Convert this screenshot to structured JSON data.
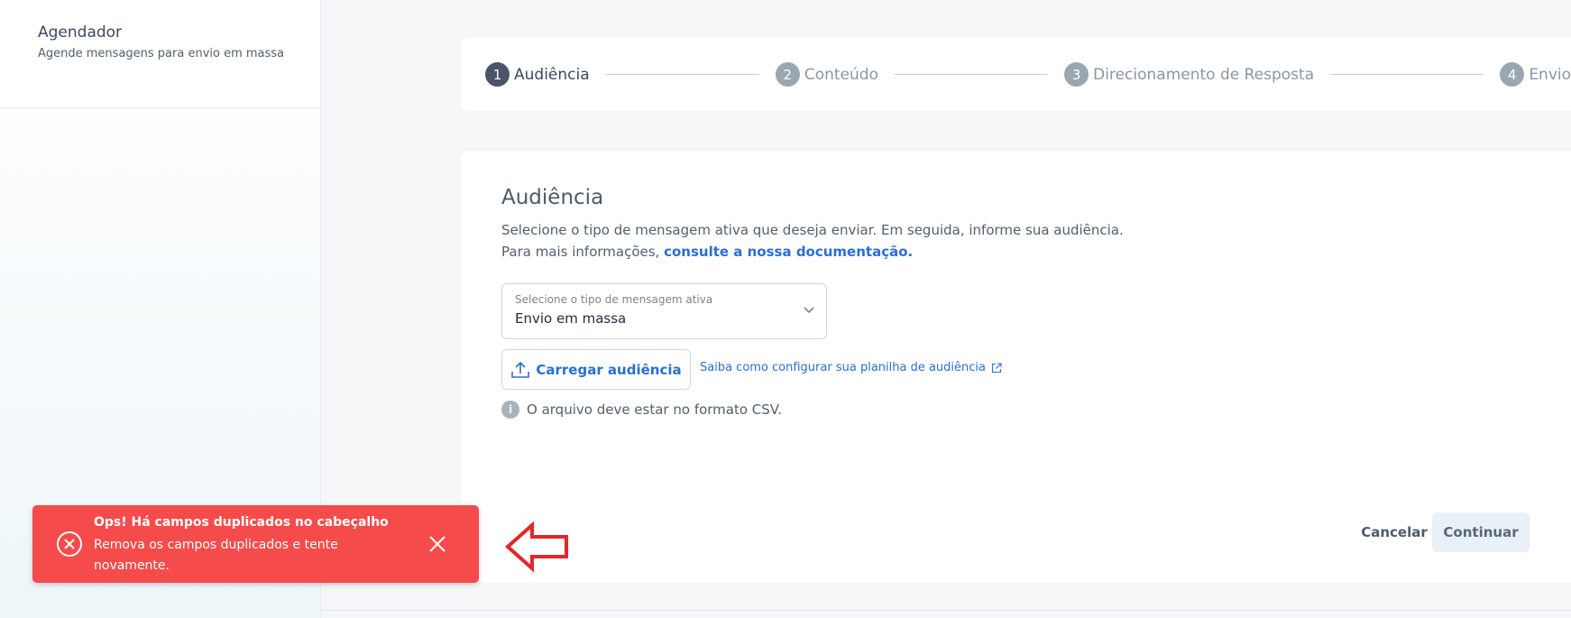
{
  "sidebar": {
    "title": "Agendador",
    "subtitle": "Agende mensagens para envio em massa"
  },
  "stepper": {
    "steps": [
      {
        "num": "1",
        "label": "Audiência",
        "active": true
      },
      {
        "num": "2",
        "label": "Conteúdo",
        "active": false
      },
      {
        "num": "3",
        "label": "Direcionamento de Resposta",
        "active": false
      },
      {
        "num": "4",
        "label": "Envio",
        "active": false
      }
    ]
  },
  "main": {
    "title": "Audiência",
    "description": "Selecione o tipo de mensagem ativa que deseja enviar. Em seguida, informe sua audiência. Para mais informações, ",
    "doc_link": "consulte a nossa documentação.",
    "select": {
      "label": "Selecione o tipo de mensagem ativa",
      "value": "Envio em massa"
    },
    "upload_label": "Carregar audiência",
    "help_link": "Saiba como configurar sua planilha de audiência",
    "info_text": "O arquivo deve estar no formato CSV.",
    "cancel_label": "Cancelar",
    "continue_label": "Continuar"
  },
  "toast": {
    "title": "Ops! Há campos duplicados no cabeçalho",
    "message": "Remova os campos duplicados e tente novamente."
  },
  "colors": {
    "accent": "#2b6fd1",
    "toast_bg": "#f54b4b",
    "arrow": "#e3262b"
  }
}
